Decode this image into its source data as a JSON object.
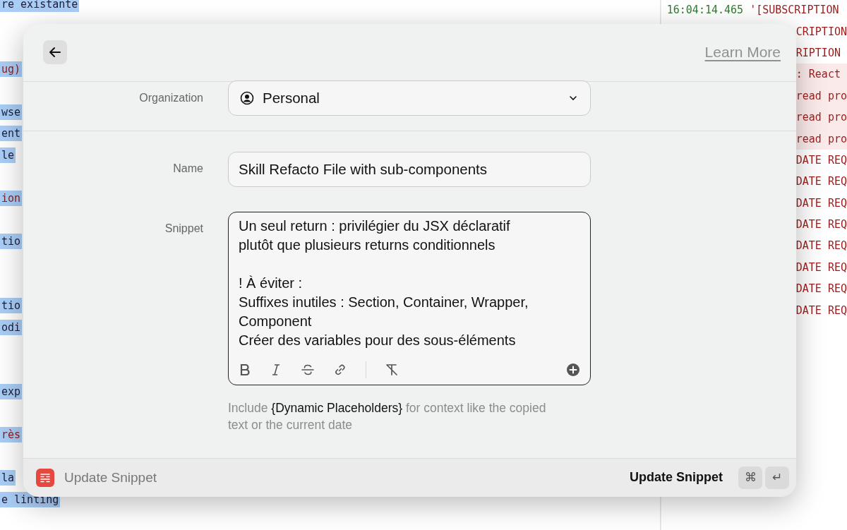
{
  "editor": {
    "lines": [
      {
        "kind": "code",
        "text": "re existante"
      },
      {
        "kind": "blank"
      },
      {
        "kind": "blank"
      },
      {
        "kind": "error",
        "text": "ug)"
      },
      {
        "kind": "blank"
      },
      {
        "kind": "code",
        "text": "wse"
      },
      {
        "kind": "code",
        "text": "ent"
      },
      {
        "kind": "code",
        "text": "le"
      },
      {
        "kind": "blank"
      },
      {
        "kind": "error",
        "text": "ion"
      },
      {
        "kind": "blank"
      },
      {
        "kind": "code",
        "text": "tio"
      },
      {
        "kind": "blank"
      },
      {
        "kind": "blank"
      },
      {
        "kind": "code",
        "text": "tio"
      },
      {
        "kind": "code",
        "text": "odi"
      },
      {
        "kind": "blank"
      },
      {
        "kind": "blank"
      },
      {
        "kind": "code",
        "text": "exp"
      },
      {
        "kind": "blank"
      },
      {
        "kind": "error",
        "text": "rès"
      },
      {
        "kind": "blank"
      },
      {
        "kind": "code",
        "text": "la"
      },
      {
        "kind": "code",
        "text": "e linting"
      }
    ]
  },
  "log": {
    "lines": [
      {
        "kind": "info",
        "time": "16:04:14.465",
        "text": "'[SUBSCRIPTION"
      },
      {
        "kind": "info",
        "text": "CRIPTION"
      },
      {
        "kind": "info",
        "text": "RIPTION"
      },
      {
        "kind": "error",
        "text": ": React"
      },
      {
        "kind": "error",
        "text": "read pro"
      },
      {
        "kind": "error",
        "text": "read pro"
      },
      {
        "kind": "error",
        "text": "read pro"
      },
      {
        "kind": "info",
        "text": "DATE REQ"
      },
      {
        "kind": "info",
        "text": "DATE REQ"
      },
      {
        "kind": "info",
        "text": "DATE REQ"
      },
      {
        "kind": "info",
        "text": "DATE REQ"
      },
      {
        "kind": "info",
        "text": "DATE REQ"
      },
      {
        "kind": "info",
        "text": "DATE REQ"
      },
      {
        "kind": "info",
        "text": "DATE REQ"
      },
      {
        "kind": "info",
        "text": "DATE REQ"
      }
    ]
  },
  "dialog": {
    "learn_more": "Learn More",
    "organization": {
      "label": "Organization",
      "value": "Personal"
    },
    "name": {
      "label": "Name",
      "value": "Skill Refacto File with sub-components"
    },
    "snippet": {
      "label": "Snippet",
      "text": "Un seul return : privilégier du JSX déclaratif plutôt que plusieurs returns conditionnels\n\n! À éviter :\nSuffixes inutiles : Section, Container, Wrapper, Component\nCréer des variables pour des sous-éléments"
    },
    "hint": "Include **{Dynamic Placeholders}** for context like the copied text or the current date",
    "footer": {
      "title": "Update Snippet",
      "action": "Update Snippet",
      "keys": [
        "⌘",
        "↵"
      ]
    }
  }
}
